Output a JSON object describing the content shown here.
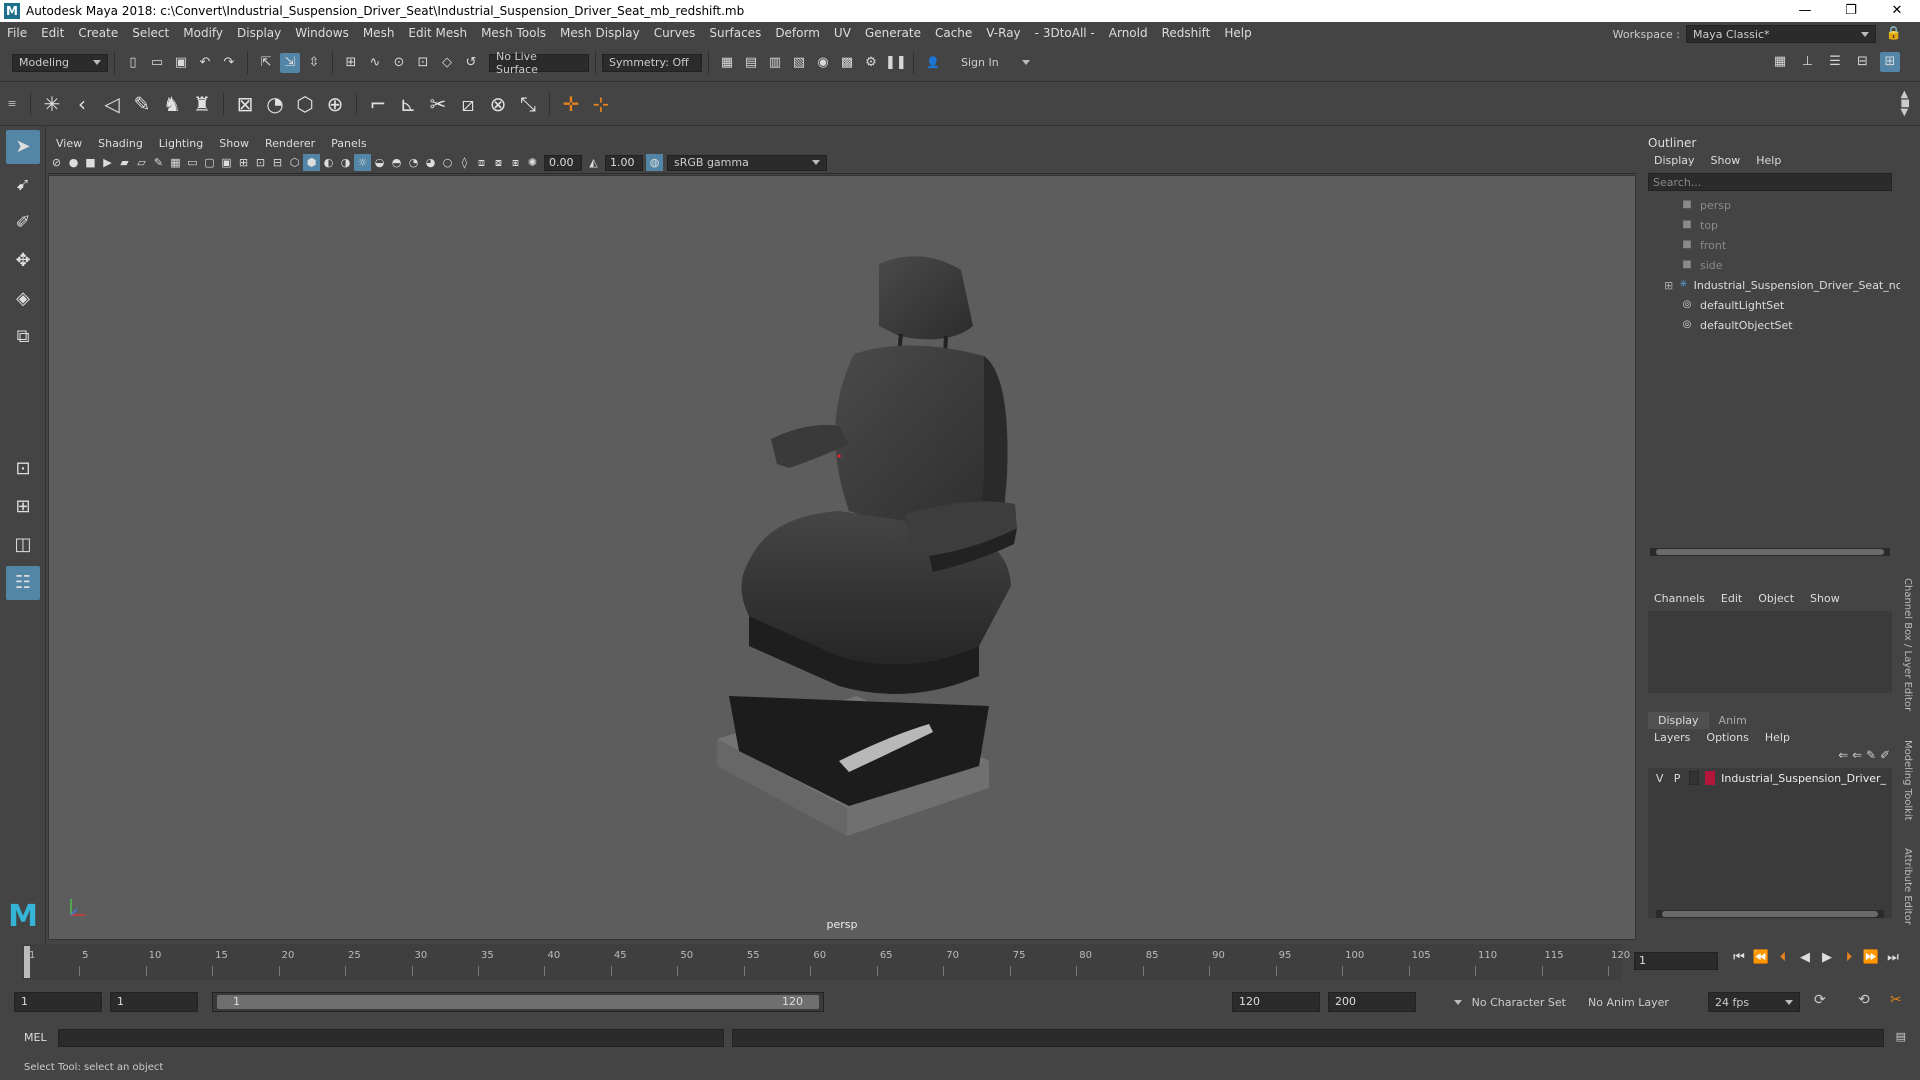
{
  "window": {
    "title": "Autodesk Maya 2018: c:\\Convert\\Industrial_Suspension_Driver_Seat\\Industrial_Suspension_Driver_Seat_mb_redshift.mb",
    "logo": "M",
    "minimize": "—",
    "maximize": "❐",
    "close": "✕"
  },
  "menubar": {
    "items": [
      "File",
      "Edit",
      "Create",
      "Select",
      "Modify",
      "Display",
      "Windows",
      "Mesh",
      "Edit Mesh",
      "Mesh Tools",
      "Mesh Display",
      "Curves",
      "Surfaces",
      "Deform",
      "UV",
      "Generate",
      "Cache",
      "V-Ray",
      "- 3DtoAll -",
      "Arnold",
      "Redshift",
      "Help"
    ],
    "workspace_label": "Workspace :",
    "workspace_value": "Maya Classic*"
  },
  "statusline": {
    "mode": "Modeling",
    "live_surface": "No Live Surface",
    "symmetry": "Symmetry: Off",
    "sign_in": "Sign In"
  },
  "viewport": {
    "menu": [
      "View",
      "Shading",
      "Lighting",
      "Show",
      "Renderer",
      "Panels"
    ],
    "exposure": "0.00",
    "gamma": "1.00",
    "colorspace": "sRGB gamma",
    "camera": "persp"
  },
  "outliner": {
    "title": "Outliner",
    "menu": [
      "Display",
      "Show",
      "Help"
    ],
    "search_placeholder": "Search...",
    "items": [
      {
        "label": "persp",
        "kind": "camera",
        "dim": true
      },
      {
        "label": "top",
        "kind": "camera",
        "dim": true
      },
      {
        "label": "front",
        "kind": "camera",
        "dim": true
      },
      {
        "label": "side",
        "kind": "camera",
        "dim": true
      },
      {
        "label": "Industrial_Suspension_Driver_Seat_ncl1_",
        "kind": "group",
        "dim": false
      },
      {
        "label": "defaultLightSet",
        "kind": "set",
        "dim": false
      },
      {
        "label": "defaultObjectSet",
        "kind": "set",
        "dim": false
      }
    ]
  },
  "channelbox": {
    "menu": [
      "Channels",
      "Edit",
      "Object",
      "Show"
    ]
  },
  "layereditor": {
    "tabs": [
      "Display",
      "Anim"
    ],
    "menu": [
      "Layers",
      "Options",
      "Help"
    ],
    "layer": {
      "v": "V",
      "p": "P",
      "name": "Industrial_Suspension_Driver_",
      "color": "#b3153b"
    }
  },
  "sidetabs": [
    "Channel Box / Layer Editor",
    "Modeling Toolkit",
    "Attribute Editor"
  ],
  "timeslider": {
    "ticks": [
      "1",
      "5",
      "10",
      "15",
      "20",
      "25",
      "30",
      "35",
      "40",
      "45",
      "50",
      "55",
      "60",
      "65",
      "70",
      "75",
      "80",
      "85",
      "90",
      "95",
      "100",
      "105",
      "110",
      "115",
      "120"
    ],
    "current_frame": "1"
  },
  "rangeslider": {
    "start": "1",
    "playback_start": "1",
    "range_start_label": "1",
    "range_end_label": "120",
    "playback_end": "120",
    "end": "200",
    "character_set": "No Character Set",
    "anim_layer": "No Anim Layer",
    "fps": "24 fps"
  },
  "cmdline": {
    "language": "MEL"
  },
  "helpline": {
    "text": "Select Tool: select an object"
  }
}
